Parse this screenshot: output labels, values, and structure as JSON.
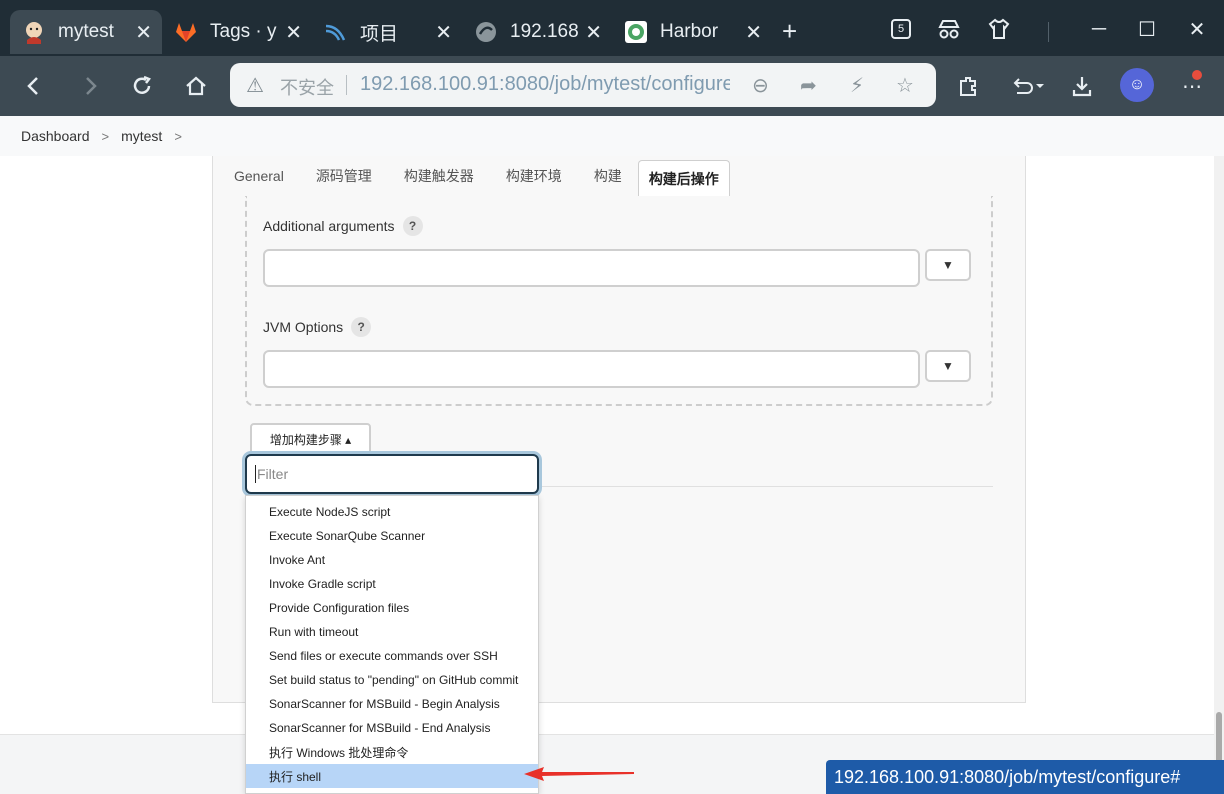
{
  "browser": {
    "tabs": [
      {
        "title": "mytest",
        "icon": "jenkins-icon",
        "active": true
      },
      {
        "title": "Tags · y",
        "icon": "gitlab-icon",
        "active": false
      },
      {
        "title": "项目",
        "icon": "sonar-icon",
        "active": false
      },
      {
        "title": "192.168",
        "icon": "globe-icon",
        "active": false
      },
      {
        "title": "Harbor",
        "icon": "harbor-icon",
        "active": false
      }
    ],
    "tab_count_badge": "5",
    "security_label": "不安全",
    "url": "192.168.100.91:8080/job/mytest/configure"
  },
  "breadcrumb": {
    "items": [
      "Dashboard",
      "mytest"
    ]
  },
  "config_tabs": [
    "General",
    "源码管理",
    "构建触发器",
    "构建环境",
    "构建",
    "构建后操作"
  ],
  "form": {
    "additional_arguments_label": "Additional arguments",
    "jvm_options_label": "JVM Options",
    "help_glyph": "?",
    "dropdown_glyph": "▼",
    "add_step_label": "增加构建步骤 ▴"
  },
  "filter": {
    "placeholder": "Filter"
  },
  "menu_items": [
    "Execute NodeJS script",
    "Execute SonarQube Scanner",
    "Invoke Ant",
    "Invoke Gradle script",
    "Provide Configuration files",
    "Run with timeout",
    "Send files or execute commands over SSH",
    "Set build status to \"pending\" on GitHub commit",
    "SonarScanner for MSBuild - Begin Analysis",
    "SonarScanner for MSBuild - End Analysis",
    "执行 Windows 批处理命令",
    "执行 shell"
  ],
  "highlighted_item": "执行 shell",
  "status_bar_url": "192.168.100.91:8080/job/mytest/configure#",
  "colors": {
    "tabstrip": "#202d36",
    "toolbar": "#3d4a53",
    "highlight": "#b7d5f7",
    "status_bar": "#1e5ba8",
    "arrow": "#e8312a"
  }
}
